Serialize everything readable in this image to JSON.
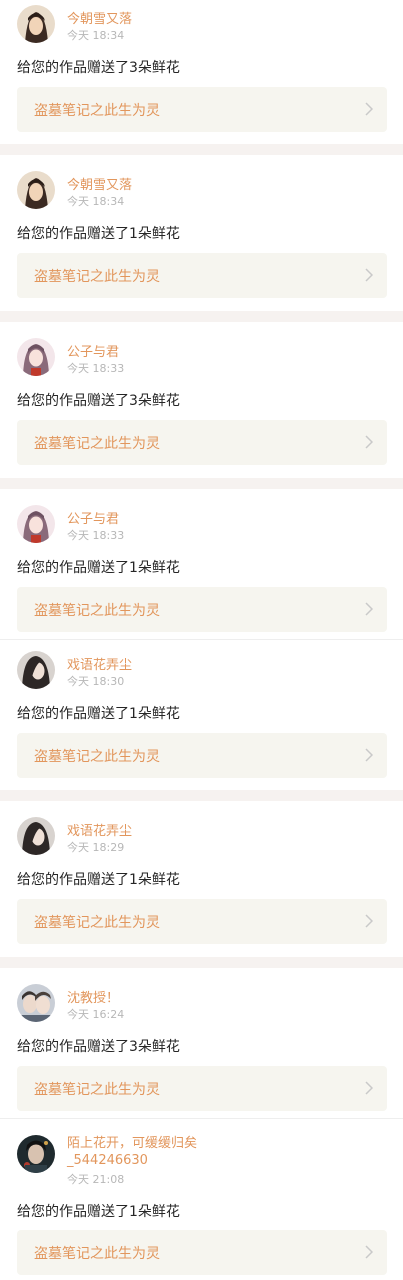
{
  "colors": {
    "accent": "#e2965c",
    "meta": "#b7b7b7",
    "text": "#262626",
    "card_bg": "#f6f5ef",
    "separator": "#f6f2f0"
  },
  "icons": {
    "chevron": "chevron-right-icon"
  },
  "notifications": [
    {
      "user": "今朝雪又落",
      "time": "今天 18:34",
      "message": "给您的作品赠送了3朵鲜花",
      "work_title": "盗墓笔记之此生为灵"
    },
    {
      "user": "今朝雪又落",
      "time": "今天 18:34",
      "message": "给您的作品赠送了1朵鲜花",
      "work_title": "盗墓笔记之此生为灵"
    },
    {
      "user": "公子与君",
      "time": "今天 18:33",
      "message": "给您的作品赠送了3朵鲜花",
      "work_title": "盗墓笔记之此生为灵"
    },
    {
      "user": "公子与君",
      "time": "今天 18:33",
      "message": "给您的作品赠送了1朵鲜花",
      "work_title": "盗墓笔记之此生为灵"
    },
    {
      "user": "戏语花弄尘",
      "time": "今天 18:30",
      "message": "给您的作品赠送了1朵鲜花",
      "work_title": "盗墓笔记之此生为灵"
    },
    {
      "user": "戏语花弄尘",
      "time": "今天 18:29",
      "message": "给您的作品赠送了1朵鲜花",
      "work_title": "盗墓笔记之此生为灵"
    },
    {
      "user": "沈教授！",
      "time": "今天 16:24",
      "message": "给您的作品赠送了3朵鲜花",
      "work_title": "盗墓笔记之此生为灵"
    },
    {
      "user": "陌上花开，可缓缓归矣_544246630",
      "time": "今天 21:08",
      "message": "给您的作品赠送了1朵鲜花",
      "work_title": "盗墓笔记之此生为灵"
    }
  ]
}
